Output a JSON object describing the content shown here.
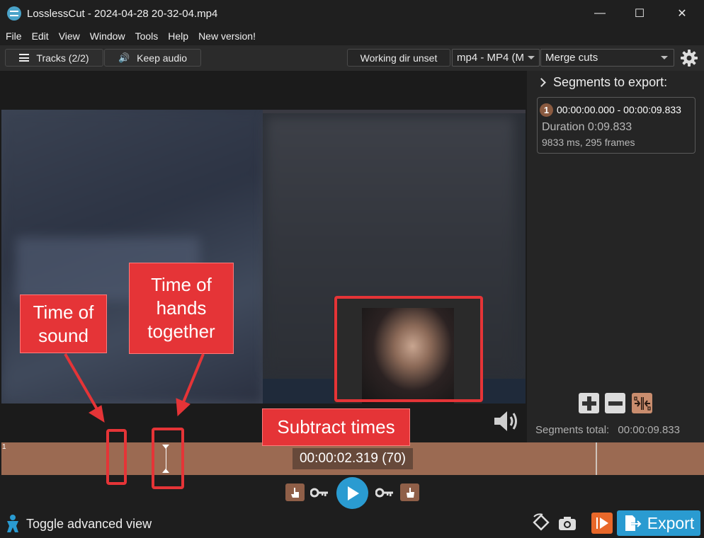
{
  "window": {
    "title": "LosslessCut - 2024-04-28 20-32-04.mp4",
    "minimize_glyph": "—",
    "maximize_glyph": "☐",
    "close_glyph": "✕"
  },
  "menu": {
    "items": [
      "File",
      "Edit",
      "View",
      "Window",
      "Tools",
      "Help",
      "New version!"
    ]
  },
  "toolbar": {
    "tracks_label": "Tracks (2/2)",
    "audio_label": "Keep audio",
    "working_dir_label": "Working dir unset",
    "format_value": "mp4 - MP4 (M",
    "merge_value": "Merge cuts"
  },
  "segments": {
    "header": "Segments to export:",
    "items": [
      {
        "number": "1",
        "range": "00:00:00.000 - 00:00:09.833",
        "duration": "Duration 0:09.833",
        "detail": "9833 ms, 295 frames"
      }
    ],
    "total_label": "Segments total:",
    "total_value": "00:00:09.833"
  },
  "timeline": {
    "segment_number": "1",
    "current_time": "00:00:02.319 (70)"
  },
  "footer": {
    "toggle_label": "Toggle advanced view",
    "export_label": "Export"
  },
  "annotations": {
    "sound": "Time of sound",
    "hands": "Time of hands together",
    "subtract": "Subtract times"
  },
  "colors": {
    "timeline": "#9b6a52",
    "accent": "#2a9bd1",
    "annotation": "#e53437",
    "export_bg": "#2a9bd1",
    "orange_btn": "#e8682a"
  }
}
